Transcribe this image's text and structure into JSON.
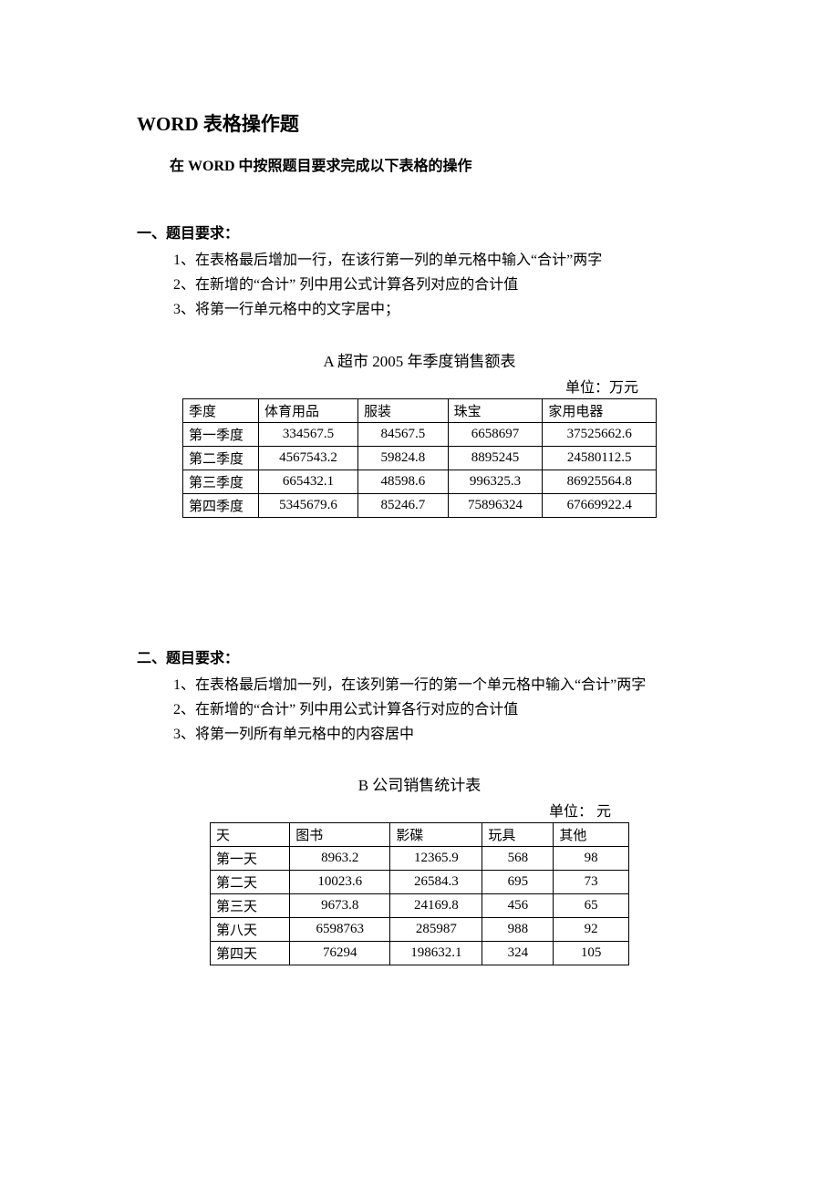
{
  "main_title": "WORD 表格操作题",
  "subtitle": "在 WORD 中按照题目要求完成以下表格的操作",
  "section1": {
    "heading": "一、题目要求：",
    "reqs": [
      "1、在表格最后增加一行，在该行第一列的单元格中输入“合计”两字",
      "2、在新增的“合计” 列中用公式计算各列对应的合计值",
      "3、将第一行单元格中的文字居中；"
    ],
    "table_title": "A 超市 2005 年季度销售额表",
    "unit": "单位：万元",
    "headers": [
      "季度",
      "体育用品",
      "服装",
      "珠宝",
      "家用电器"
    ],
    "rows": [
      [
        "第一季度",
        "334567.5",
        "84567.5",
        "6658697",
        "37525662.6"
      ],
      [
        "第二季度",
        "4567543.2",
        "59824.8",
        "8895245",
        "24580112.5"
      ],
      [
        "第三季度",
        "665432.1",
        "48598.6",
        "996325.3",
        "86925564.8"
      ],
      [
        "第四季度",
        "5345679.6",
        "85246.7",
        "75896324",
        "67669922.4"
      ]
    ]
  },
  "section2": {
    "heading": "二、题目要求：",
    "reqs": [
      "1、在表格最后增加一列，在该列第一行的第一个单元格中输入“合计”两字",
      "2、在新增的“合计” 列中用公式计算各行对应的合计值",
      "3、将第一列所有单元格中的内容居中"
    ],
    "table_title": "B 公司销售统计表",
    "unit": "单位： 元",
    "headers": [
      "天",
      "图书",
      "影碟",
      "玩具",
      "其他"
    ],
    "rows": [
      [
        "第一天",
        "8963.2",
        "12365.9",
        "568",
        "98"
      ],
      [
        "第二天",
        "10023.6",
        "26584.3",
        "695",
        "73"
      ],
      [
        "第三天",
        "9673.8",
        "24169.8",
        "456",
        "65"
      ],
      [
        "第八天",
        "6598763",
        "285987",
        "988",
        "92"
      ],
      [
        "第四天",
        "76294",
        "198632.1",
        "324",
        "105"
      ]
    ]
  }
}
